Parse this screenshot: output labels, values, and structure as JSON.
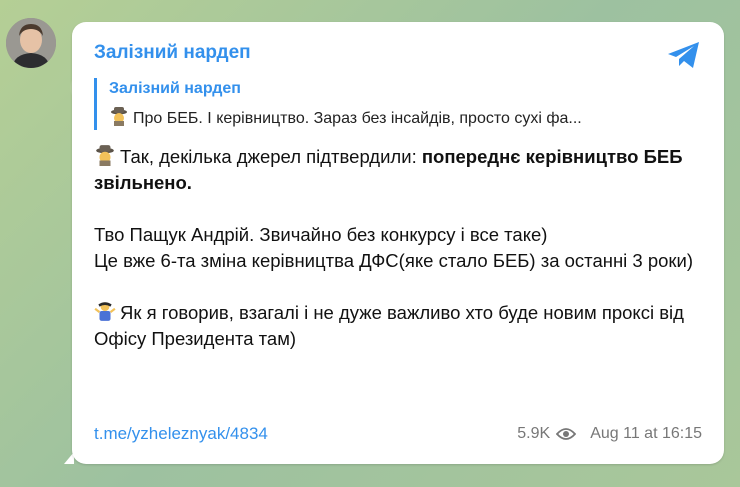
{
  "channel": {
    "name": "Залізний нардеп"
  },
  "reply": {
    "author": "Залізний нардеп",
    "excerpt": "Про БЕБ. І керівництво. Зараз без інсайдів, просто сухі фа..."
  },
  "message": {
    "p1_normal": "Так, декілька джерел підтвердили: ",
    "p1_bold": "попереднє керівництво БЕБ звільнено.",
    "p2": "Тво Пащук Андрій. Звичайно без конкурсу і все таке)",
    "p3": "Це вже 6-та зміна керівництва ДФС(яке стало БЕБ) за останні 3 роки)",
    "p4": "Як я говорив, взагалі і не дуже важливо хто буде новим проксі від Офісу Президента там)"
  },
  "footer": {
    "link": "t.me/yzheleznyak/4834",
    "views": "5.9K",
    "timestamp": "Aug 11 at 16:15"
  },
  "colors": {
    "accent": "#3390ec",
    "background": "#a9c79a"
  },
  "icons": [
    "avatar",
    "telegram-share-icon",
    "detective-emoji",
    "shrug-emoji",
    "eye-icon"
  ]
}
